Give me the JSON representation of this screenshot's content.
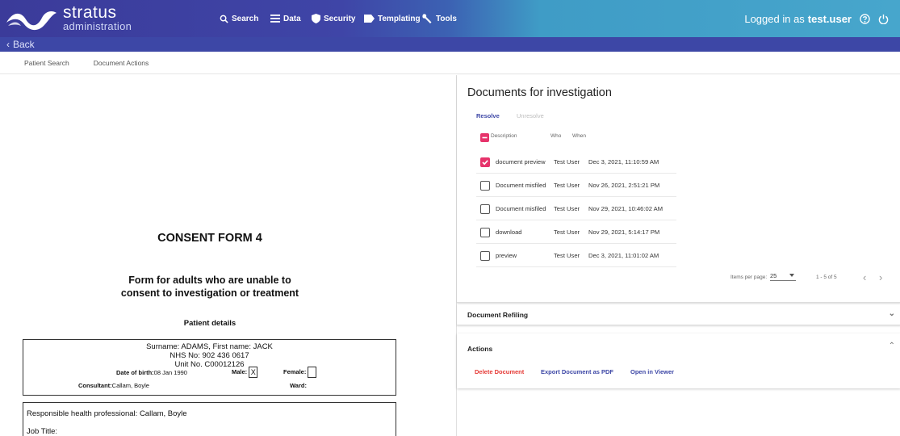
{
  "brand": {
    "name": "stratus",
    "sub": "administration"
  },
  "nav": [
    {
      "label": "Search",
      "icon": "search-icon"
    },
    {
      "label": "Data",
      "icon": "list-icon"
    },
    {
      "label": "Security",
      "icon": "shield-icon"
    },
    {
      "label": "Templating",
      "icon": "tag-icon"
    },
    {
      "label": "Tools",
      "icon": "wrench-icon"
    }
  ],
  "user": {
    "prefix": "Logged in as",
    "name": "test.user"
  },
  "back_label": "Back",
  "crumbs": [
    "Patient Search",
    "Document Actions"
  ],
  "document": {
    "title": "CONSENT FORM 4",
    "subtitle1": "Form for adults who are unable to",
    "subtitle2": "consent to investigation or treatment",
    "patient_details": "Patient details",
    "line1": "Surname: ADAMS, First name: JACK",
    "line2": "NHS No: 902 436 0617",
    "line3": "Unit No. C00012126",
    "dob_label": "Date of birth:",
    "dob_value": "08 Jan 1990",
    "male_label": "Male:",
    "male_value": "X",
    "female_label": "Female:",
    "consultant_label": "Consultant:",
    "consultant_value": "Callam, Boyle",
    "ward_label": "Ward:",
    "responsible": "Responsible health professional: Callam, Boyle",
    "job_title": "Job Title:"
  },
  "panel": {
    "title": "Documents for investigation",
    "tabs": {
      "resolve": "Resolve",
      "unresolve": "Unresolve"
    },
    "columns": {
      "description": "Description",
      "who": "Who",
      "when": "When"
    },
    "rows": [
      {
        "description": "document preview",
        "who": "Test User",
        "when": "Dec 3, 2021, 11:10:59 AM",
        "checked": true
      },
      {
        "description": "Document misfiled",
        "who": "Test User",
        "when": "Nov 26, 2021, 2:51:21 PM",
        "checked": false
      },
      {
        "description": "Document misfiled",
        "who": "Test User",
        "when": "Nov 29, 2021, 10:46:02 AM",
        "checked": false
      },
      {
        "description": "download",
        "who": "Test User",
        "when": "Nov 29, 2021, 5:14:17 PM",
        "checked": false
      },
      {
        "description": "preview",
        "who": "Test User",
        "when": "Dec 3, 2021, 11:01:02 AM",
        "checked": false
      }
    ],
    "pager": {
      "label": "Items per page:",
      "value": "25",
      "range": "1 - 5 of 5"
    }
  },
  "refiling": {
    "title": "Document Refiling"
  },
  "actions": {
    "title": "Actions",
    "delete": "Delete Document",
    "export": "Export Document as PDF",
    "open": "Open in Viewer"
  },
  "colors": {
    "accent": "#e6336b",
    "link": "#3d47a6",
    "danger": "#e53935"
  }
}
